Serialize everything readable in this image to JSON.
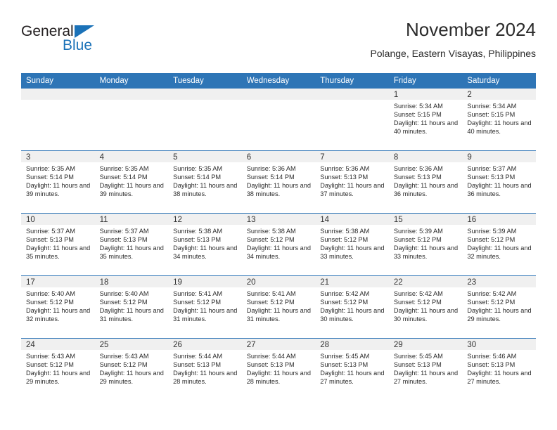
{
  "brand": {
    "name_part1": "General",
    "name_part2": "Blue",
    "accent_color": "#1b72b8"
  },
  "header": {
    "title": "November 2024",
    "subtitle": "Polange, Eastern Visayas, Philippines"
  },
  "theme": {
    "header_blue": "#2e75b6",
    "daynum_band": "#f0f0f0",
    "text": "#2b2b2b"
  },
  "calendar": {
    "weekday_headers": [
      "Sunday",
      "Monday",
      "Tuesday",
      "Wednesday",
      "Thursday",
      "Friday",
      "Saturday"
    ],
    "weeks": [
      [
        {
          "day": "",
          "empty": true
        },
        {
          "day": "",
          "empty": true
        },
        {
          "day": "",
          "empty": true
        },
        {
          "day": "",
          "empty": true
        },
        {
          "day": "",
          "empty": true
        },
        {
          "day": "1",
          "sunrise": "Sunrise: 5:34 AM",
          "sunset": "Sunset: 5:15 PM",
          "daylight": "Daylight: 11 hours and 40 minutes."
        },
        {
          "day": "2",
          "sunrise": "Sunrise: 5:34 AM",
          "sunset": "Sunset: 5:15 PM",
          "daylight": "Daylight: 11 hours and 40 minutes."
        }
      ],
      [
        {
          "day": "3",
          "sunrise": "Sunrise: 5:35 AM",
          "sunset": "Sunset: 5:14 PM",
          "daylight": "Daylight: 11 hours and 39 minutes."
        },
        {
          "day": "4",
          "sunrise": "Sunrise: 5:35 AM",
          "sunset": "Sunset: 5:14 PM",
          "daylight": "Daylight: 11 hours and 39 minutes."
        },
        {
          "day": "5",
          "sunrise": "Sunrise: 5:35 AM",
          "sunset": "Sunset: 5:14 PM",
          "daylight": "Daylight: 11 hours and 38 minutes."
        },
        {
          "day": "6",
          "sunrise": "Sunrise: 5:36 AM",
          "sunset": "Sunset: 5:14 PM",
          "daylight": "Daylight: 11 hours and 38 minutes."
        },
        {
          "day": "7",
          "sunrise": "Sunrise: 5:36 AM",
          "sunset": "Sunset: 5:13 PM",
          "daylight": "Daylight: 11 hours and 37 minutes."
        },
        {
          "day": "8",
          "sunrise": "Sunrise: 5:36 AM",
          "sunset": "Sunset: 5:13 PM",
          "daylight": "Daylight: 11 hours and 36 minutes."
        },
        {
          "day": "9",
          "sunrise": "Sunrise: 5:37 AM",
          "sunset": "Sunset: 5:13 PM",
          "daylight": "Daylight: 11 hours and 36 minutes."
        }
      ],
      [
        {
          "day": "10",
          "sunrise": "Sunrise: 5:37 AM",
          "sunset": "Sunset: 5:13 PM",
          "daylight": "Daylight: 11 hours and 35 minutes."
        },
        {
          "day": "11",
          "sunrise": "Sunrise: 5:37 AM",
          "sunset": "Sunset: 5:13 PM",
          "daylight": "Daylight: 11 hours and 35 minutes."
        },
        {
          "day": "12",
          "sunrise": "Sunrise: 5:38 AM",
          "sunset": "Sunset: 5:13 PM",
          "daylight": "Daylight: 11 hours and 34 minutes."
        },
        {
          "day": "13",
          "sunrise": "Sunrise: 5:38 AM",
          "sunset": "Sunset: 5:12 PM",
          "daylight": "Daylight: 11 hours and 34 minutes."
        },
        {
          "day": "14",
          "sunrise": "Sunrise: 5:38 AM",
          "sunset": "Sunset: 5:12 PM",
          "daylight": "Daylight: 11 hours and 33 minutes."
        },
        {
          "day": "15",
          "sunrise": "Sunrise: 5:39 AM",
          "sunset": "Sunset: 5:12 PM",
          "daylight": "Daylight: 11 hours and 33 minutes."
        },
        {
          "day": "16",
          "sunrise": "Sunrise: 5:39 AM",
          "sunset": "Sunset: 5:12 PM",
          "daylight": "Daylight: 11 hours and 32 minutes."
        }
      ],
      [
        {
          "day": "17",
          "sunrise": "Sunrise: 5:40 AM",
          "sunset": "Sunset: 5:12 PM",
          "daylight": "Daylight: 11 hours and 32 minutes."
        },
        {
          "day": "18",
          "sunrise": "Sunrise: 5:40 AM",
          "sunset": "Sunset: 5:12 PM",
          "daylight": "Daylight: 11 hours and 31 minutes."
        },
        {
          "day": "19",
          "sunrise": "Sunrise: 5:41 AM",
          "sunset": "Sunset: 5:12 PM",
          "daylight": "Daylight: 11 hours and 31 minutes."
        },
        {
          "day": "20",
          "sunrise": "Sunrise: 5:41 AM",
          "sunset": "Sunset: 5:12 PM",
          "daylight": "Daylight: 11 hours and 31 minutes."
        },
        {
          "day": "21",
          "sunrise": "Sunrise: 5:42 AM",
          "sunset": "Sunset: 5:12 PM",
          "daylight": "Daylight: 11 hours and 30 minutes."
        },
        {
          "day": "22",
          "sunrise": "Sunrise: 5:42 AM",
          "sunset": "Sunset: 5:12 PM",
          "daylight": "Daylight: 11 hours and 30 minutes."
        },
        {
          "day": "23",
          "sunrise": "Sunrise: 5:42 AM",
          "sunset": "Sunset: 5:12 PM",
          "daylight": "Daylight: 11 hours and 29 minutes."
        }
      ],
      [
        {
          "day": "24",
          "sunrise": "Sunrise: 5:43 AM",
          "sunset": "Sunset: 5:12 PM",
          "daylight": "Daylight: 11 hours and 29 minutes."
        },
        {
          "day": "25",
          "sunrise": "Sunrise: 5:43 AM",
          "sunset": "Sunset: 5:12 PM",
          "daylight": "Daylight: 11 hours and 29 minutes."
        },
        {
          "day": "26",
          "sunrise": "Sunrise: 5:44 AM",
          "sunset": "Sunset: 5:13 PM",
          "daylight": "Daylight: 11 hours and 28 minutes."
        },
        {
          "day": "27",
          "sunrise": "Sunrise: 5:44 AM",
          "sunset": "Sunset: 5:13 PM",
          "daylight": "Daylight: 11 hours and 28 minutes."
        },
        {
          "day": "28",
          "sunrise": "Sunrise: 5:45 AM",
          "sunset": "Sunset: 5:13 PM",
          "daylight": "Daylight: 11 hours and 27 minutes."
        },
        {
          "day": "29",
          "sunrise": "Sunrise: 5:45 AM",
          "sunset": "Sunset: 5:13 PM",
          "daylight": "Daylight: 11 hours and 27 minutes."
        },
        {
          "day": "30",
          "sunrise": "Sunrise: 5:46 AM",
          "sunset": "Sunset: 5:13 PM",
          "daylight": "Daylight: 11 hours and 27 minutes."
        }
      ]
    ]
  }
}
